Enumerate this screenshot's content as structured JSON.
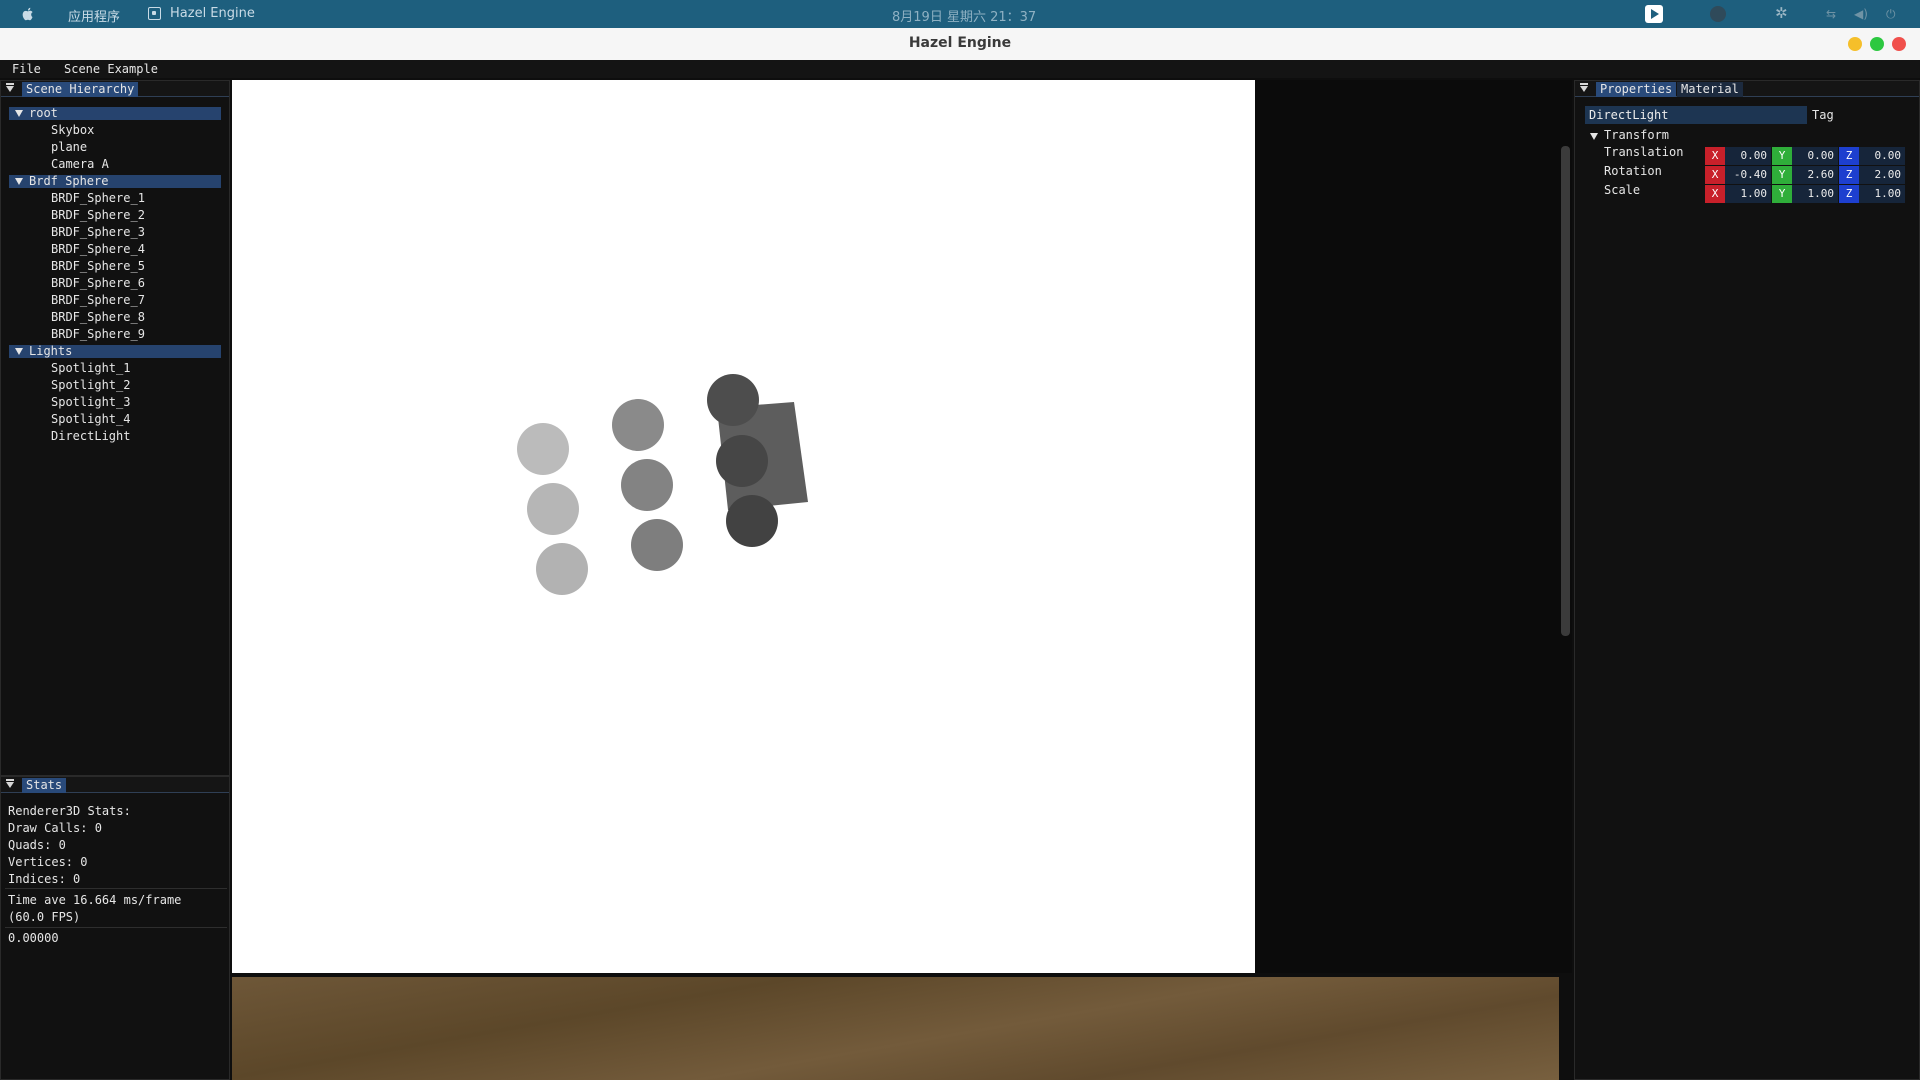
{
  "system_bar": {
    "menu_label": "应用程序",
    "app_name": "Hazel Engine",
    "datetime": "8月19日 星期六  21：37"
  },
  "window": {
    "title": "Hazel Engine"
  },
  "menu": {
    "items": [
      "File",
      "Scene Example"
    ]
  },
  "scene_hierarchy": {
    "tab": "Scene Hierarchy",
    "groups": [
      {
        "label": "root",
        "children": [
          "Skybox",
          "plane",
          "Camera A"
        ]
      },
      {
        "label": "Brdf Sphere",
        "children": [
          "BRDF_Sphere_1",
          "BRDF_Sphere_2",
          "BRDF_Sphere_3",
          "BRDF_Sphere_4",
          "BRDF_Sphere_5",
          "BRDF_Sphere_6",
          "BRDF_Sphere_7",
          "BRDF_Sphere_8",
          "BRDF_Sphere_9"
        ]
      },
      {
        "label": "Lights",
        "children": [
          "Spotlight_1",
          "Spotlight_2",
          "Spotlight_3",
          "Spotlight_4",
          "DirectLight"
        ]
      }
    ]
  },
  "stats": {
    "tab": "Stats",
    "lines": [
      "Renderer3D Stats:",
      "Draw Calls: 0",
      "Quads: 0",
      "Vertices: 0",
      "Indices: 0"
    ],
    "time_line1": "Time ave 16.664 ms/frame",
    "time_line2": "(60.0 FPS)",
    "value": "0.00000"
  },
  "properties": {
    "tabs": [
      "Properties",
      "Material"
    ],
    "name_value": "DirectLight",
    "tag_label": "Tag",
    "transform_label": "Transform",
    "rows": [
      {
        "label": "Translation",
        "x": "0.00",
        "y": "0.00",
        "z": "0.00"
      },
      {
        "label": "Rotation",
        "x": "-0.40",
        "y": "2.60",
        "z": "2.00"
      },
      {
        "label": "Scale",
        "x": "1.00",
        "y": "1.00",
        "z": "1.00"
      }
    ],
    "axis_labels": [
      "X",
      "Y",
      "Z"
    ]
  },
  "colors": {
    "selection": "#26436e",
    "tab_active": "#294a7a",
    "axis_x": "#c8202a",
    "axis_y": "#2fae3a",
    "axis_z": "#1d3fcf",
    "system_bar": "#1e5f7e"
  }
}
